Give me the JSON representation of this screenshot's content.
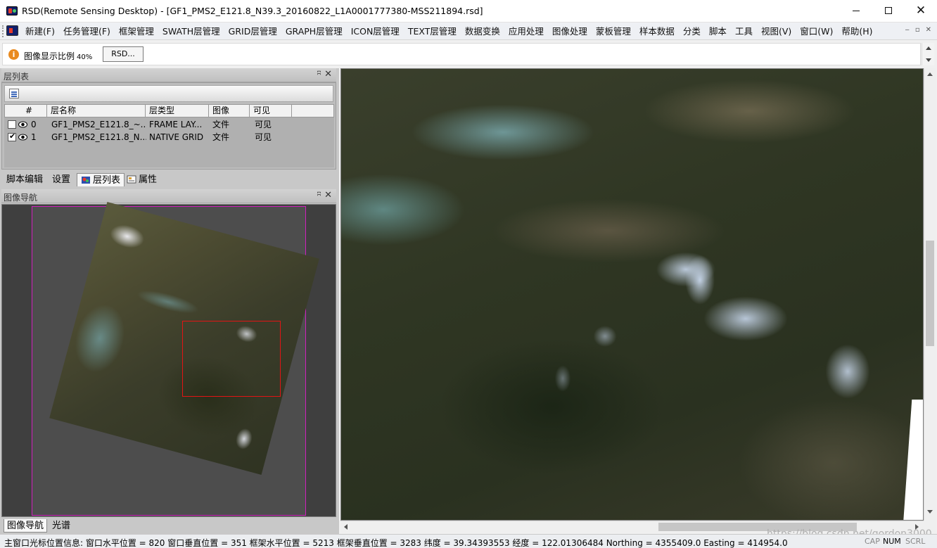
{
  "window": {
    "title": "RSD(Remote Sensing Desktop) - [GF1_PMS2_E121.8_N39.3_20160822_L1A0001777380-MSS211894.rsd]",
    "controls": {
      "minimize": "minimize-icon",
      "maximize": "maximize-icon",
      "close": "✕"
    }
  },
  "menu": {
    "items": [
      "新建(F)",
      "任务管理(F)",
      "框架管理",
      "SWATH层管理",
      "GRID层管理",
      "GRAPH层管理",
      "ICON层管理",
      "TEXT层管理",
      "数据变换",
      "应用处理",
      "图像处理",
      "蒙板管理",
      "样本数据",
      "分类",
      "脚本",
      "工具",
      "视图(V)",
      "窗口(W)",
      "帮助(H)"
    ],
    "mdi_controls": [
      "‒",
      "▫",
      "✕"
    ]
  },
  "infobar": {
    "text": "图像显示比例",
    "percent": "40%",
    "button": "RSD...",
    "icon": "info-icon"
  },
  "layer_panel": {
    "title": "层列表",
    "pin": "ʭ",
    "close": "✕",
    "columns": [
      "#",
      "层名称",
      "层类型",
      "图像",
      "可见"
    ],
    "rows": [
      {
        "checked": false,
        "index": "0",
        "name": "GF1_PMS2_E121.8_~...",
        "type": "FRAME LAY...",
        "image": "文件",
        "visible": "可见"
      },
      {
        "checked": true,
        "index": "1",
        "name": "GF1_PMS2_E121.8_N...",
        "type": "NATIVE GRID",
        "image": "文件",
        "visible": "可见"
      }
    ]
  },
  "panel_tabs": [
    "脚本编辑",
    "设置",
    "层列表",
    "属性"
  ],
  "nav_panel": {
    "title": "图像导航",
    "pin": "ʭ",
    "close": "✕"
  },
  "bottom_tabs": [
    "图像导航",
    "光谱"
  ],
  "statusbar": {
    "text": "主窗口光标位置信息:  窗口水平位置 = 820 窗口垂直位置 = 351 框架水平位置 = 5213 框架垂直位置 = 3283 纬度 = 39.34393553 经度 = 122.01306484 Northing = 4355409.0 Easting = 414954.0",
    "indicators": [
      "CAP",
      "NUM",
      "SCRL"
    ]
  },
  "watermark": "https://blog.csdn.net/gordon3000",
  "colors": {
    "nav_rect": "#e31414",
    "nav_frame": "#d01fbd",
    "accent_info": "#e98a1f"
  }
}
